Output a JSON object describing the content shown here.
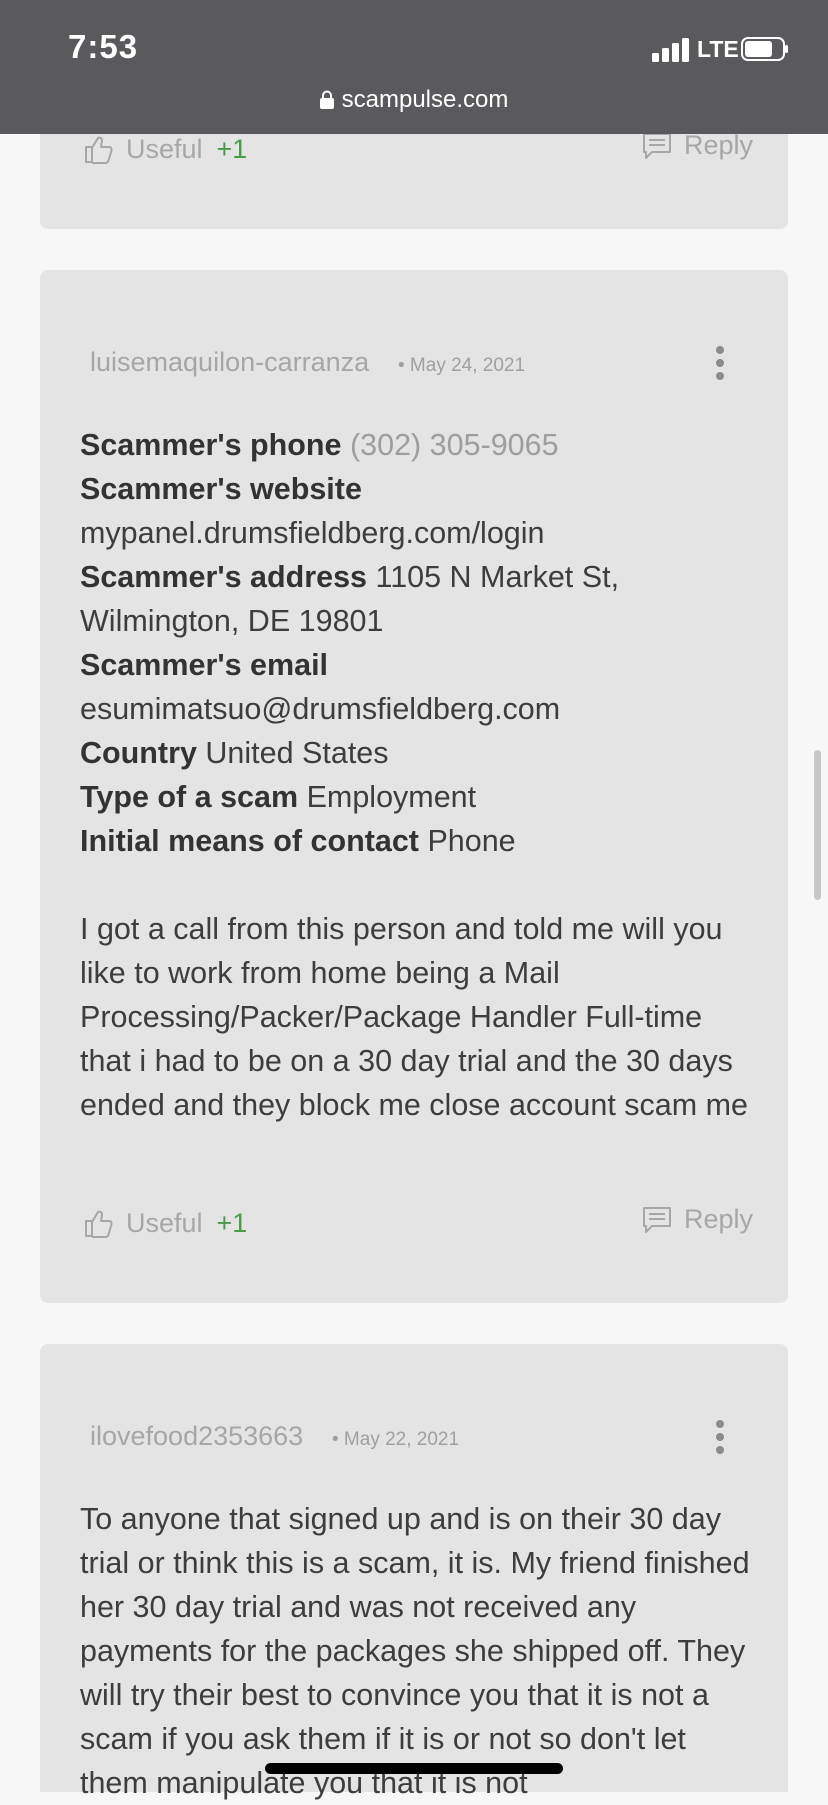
{
  "status_bar": {
    "time": "7:53",
    "network": "LTE",
    "url": "scampulse.com"
  },
  "top_card": {
    "useful_label": "Useful",
    "useful_count": "+1",
    "reply_label": "Reply"
  },
  "report": {
    "author": "luisemaquilon-carranza",
    "date": "• May 24, 2021",
    "fields": {
      "phone_label": "Scammer's phone",
      "phone_value": "(302) 305-9065",
      "website_label": "Scammer's website",
      "website_value": "mypanel.drumsfieldberg.com/login",
      "address_label": "Scammer's address",
      "address_value": "1105 N Market St, Wilmington, DE 19801",
      "email_label": "Scammer's email",
      "email_value": "esumimatsuo@drumsfieldberg.com",
      "country_label": "Country",
      "country_value": "United States",
      "type_label": "Type of a scam",
      "type_value": "Employment",
      "contact_label": "Initial means of contact",
      "contact_value": "Phone"
    },
    "text": "I got a call from this person and told me will you like to work from home being a Mail Processing/Packer/Package Handler Full-time that i had to be on a 30 day trial and the 30 days ended and they block me close account scam me",
    "useful_label": "Useful",
    "useful_count": "+1",
    "reply_label": "Reply"
  },
  "comment": {
    "author": "ilovefood2353663",
    "date": "• May 22, 2021",
    "text": "To anyone that signed up and is on their 30 day trial or think this is a scam, it is. My friend finished her 30 day trial and was not received any payments for the packages she shipped off. They will try their best to convince you that it is not a scam if you ask them if it is or not so don't let them manipulate you that it is not"
  }
}
